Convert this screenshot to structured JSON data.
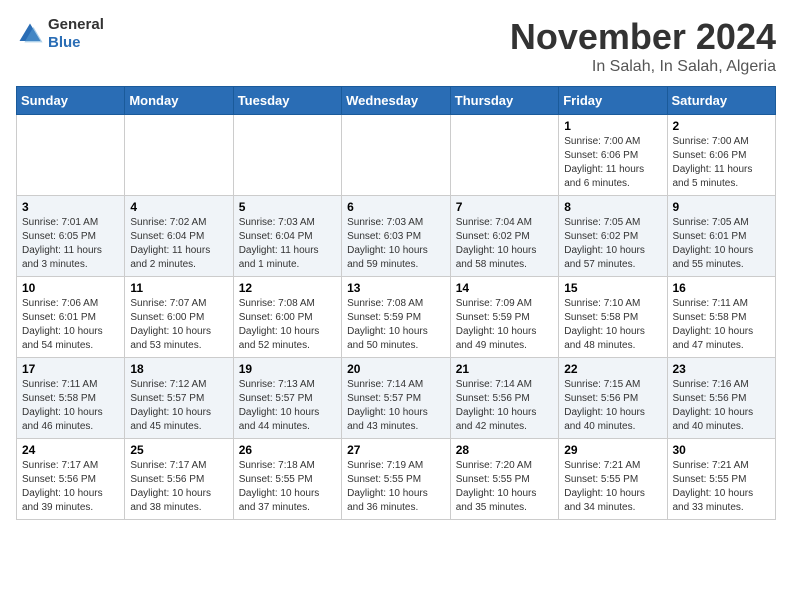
{
  "logo": {
    "general": "General",
    "blue": "Blue"
  },
  "header": {
    "month": "November 2024",
    "location": "In Salah, In Salah, Algeria"
  },
  "weekdays": [
    "Sunday",
    "Monday",
    "Tuesday",
    "Wednesday",
    "Thursday",
    "Friday",
    "Saturday"
  ],
  "weeks": [
    [
      {
        "day": "",
        "info": ""
      },
      {
        "day": "",
        "info": ""
      },
      {
        "day": "",
        "info": ""
      },
      {
        "day": "",
        "info": ""
      },
      {
        "day": "",
        "info": ""
      },
      {
        "day": "1",
        "info": "Sunrise: 7:00 AM\nSunset: 6:06 PM\nDaylight: 11 hours and 6 minutes."
      },
      {
        "day": "2",
        "info": "Sunrise: 7:00 AM\nSunset: 6:06 PM\nDaylight: 11 hours and 5 minutes."
      }
    ],
    [
      {
        "day": "3",
        "info": "Sunrise: 7:01 AM\nSunset: 6:05 PM\nDaylight: 11 hours and 3 minutes."
      },
      {
        "day": "4",
        "info": "Sunrise: 7:02 AM\nSunset: 6:04 PM\nDaylight: 11 hours and 2 minutes."
      },
      {
        "day": "5",
        "info": "Sunrise: 7:03 AM\nSunset: 6:04 PM\nDaylight: 11 hours and 1 minute."
      },
      {
        "day": "6",
        "info": "Sunrise: 7:03 AM\nSunset: 6:03 PM\nDaylight: 10 hours and 59 minutes."
      },
      {
        "day": "7",
        "info": "Sunrise: 7:04 AM\nSunset: 6:02 PM\nDaylight: 10 hours and 58 minutes."
      },
      {
        "day": "8",
        "info": "Sunrise: 7:05 AM\nSunset: 6:02 PM\nDaylight: 10 hours and 57 minutes."
      },
      {
        "day": "9",
        "info": "Sunrise: 7:05 AM\nSunset: 6:01 PM\nDaylight: 10 hours and 55 minutes."
      }
    ],
    [
      {
        "day": "10",
        "info": "Sunrise: 7:06 AM\nSunset: 6:01 PM\nDaylight: 10 hours and 54 minutes."
      },
      {
        "day": "11",
        "info": "Sunrise: 7:07 AM\nSunset: 6:00 PM\nDaylight: 10 hours and 53 minutes."
      },
      {
        "day": "12",
        "info": "Sunrise: 7:08 AM\nSunset: 6:00 PM\nDaylight: 10 hours and 52 minutes."
      },
      {
        "day": "13",
        "info": "Sunrise: 7:08 AM\nSunset: 5:59 PM\nDaylight: 10 hours and 50 minutes."
      },
      {
        "day": "14",
        "info": "Sunrise: 7:09 AM\nSunset: 5:59 PM\nDaylight: 10 hours and 49 minutes."
      },
      {
        "day": "15",
        "info": "Sunrise: 7:10 AM\nSunset: 5:58 PM\nDaylight: 10 hours and 48 minutes."
      },
      {
        "day": "16",
        "info": "Sunrise: 7:11 AM\nSunset: 5:58 PM\nDaylight: 10 hours and 47 minutes."
      }
    ],
    [
      {
        "day": "17",
        "info": "Sunrise: 7:11 AM\nSunset: 5:58 PM\nDaylight: 10 hours and 46 minutes."
      },
      {
        "day": "18",
        "info": "Sunrise: 7:12 AM\nSunset: 5:57 PM\nDaylight: 10 hours and 45 minutes."
      },
      {
        "day": "19",
        "info": "Sunrise: 7:13 AM\nSunset: 5:57 PM\nDaylight: 10 hours and 44 minutes."
      },
      {
        "day": "20",
        "info": "Sunrise: 7:14 AM\nSunset: 5:57 PM\nDaylight: 10 hours and 43 minutes."
      },
      {
        "day": "21",
        "info": "Sunrise: 7:14 AM\nSunset: 5:56 PM\nDaylight: 10 hours and 42 minutes."
      },
      {
        "day": "22",
        "info": "Sunrise: 7:15 AM\nSunset: 5:56 PM\nDaylight: 10 hours and 40 minutes."
      },
      {
        "day": "23",
        "info": "Sunrise: 7:16 AM\nSunset: 5:56 PM\nDaylight: 10 hours and 40 minutes."
      }
    ],
    [
      {
        "day": "24",
        "info": "Sunrise: 7:17 AM\nSunset: 5:56 PM\nDaylight: 10 hours and 39 minutes."
      },
      {
        "day": "25",
        "info": "Sunrise: 7:17 AM\nSunset: 5:56 PM\nDaylight: 10 hours and 38 minutes."
      },
      {
        "day": "26",
        "info": "Sunrise: 7:18 AM\nSunset: 5:55 PM\nDaylight: 10 hours and 37 minutes."
      },
      {
        "day": "27",
        "info": "Sunrise: 7:19 AM\nSunset: 5:55 PM\nDaylight: 10 hours and 36 minutes."
      },
      {
        "day": "28",
        "info": "Sunrise: 7:20 AM\nSunset: 5:55 PM\nDaylight: 10 hours and 35 minutes."
      },
      {
        "day": "29",
        "info": "Sunrise: 7:21 AM\nSunset: 5:55 PM\nDaylight: 10 hours and 34 minutes."
      },
      {
        "day": "30",
        "info": "Sunrise: 7:21 AM\nSunset: 5:55 PM\nDaylight: 10 hours and 33 minutes."
      }
    ]
  ]
}
